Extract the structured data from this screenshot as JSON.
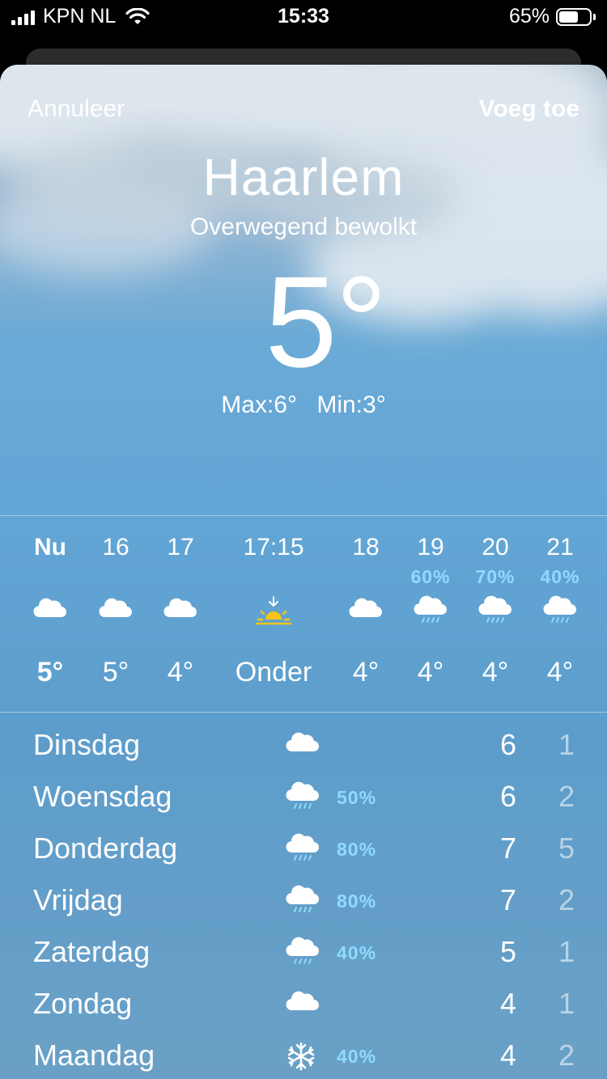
{
  "status_bar": {
    "carrier": "KPN NL",
    "time": "15:33",
    "battery_pct": "65%",
    "battery_level": 0.65,
    "icons": [
      "signal-icon",
      "wifi-icon",
      "battery-icon"
    ]
  },
  "nav": {
    "cancel_label": "Annuleer",
    "add_label": "Voeg toe"
  },
  "current": {
    "city": "Haarlem",
    "condition": "Overwegend bewolkt",
    "temperature": "5°",
    "max": "Max:6°",
    "min": "Min:3°"
  },
  "hourly": [
    {
      "label": "Nu",
      "pct": "",
      "icon": "cloud-icon",
      "temp": "5°",
      "bold": true
    },
    {
      "label": "16",
      "pct": "",
      "icon": "cloud-icon",
      "temp": "5°"
    },
    {
      "label": "17",
      "pct": "",
      "icon": "cloud-icon",
      "temp": "4°"
    },
    {
      "label": "17:15",
      "pct": "",
      "icon": "sunset-icon",
      "temp": "Onder"
    },
    {
      "label": "18",
      "pct": "",
      "icon": "cloud-icon",
      "temp": "4°"
    },
    {
      "label": "19",
      "pct": "60%",
      "icon": "cloud-rain-icon",
      "temp": "4°"
    },
    {
      "label": "20",
      "pct": "70%",
      "icon": "cloud-rain-icon",
      "temp": "4°"
    },
    {
      "label": "21",
      "pct": "40%",
      "icon": "cloud-rain-icon",
      "temp": "4°"
    }
  ],
  "daily": [
    {
      "day": "Dinsdag",
      "icon": "cloud-icon",
      "pct": "",
      "max": "6",
      "min": "1"
    },
    {
      "day": "Woensdag",
      "icon": "cloud-rain-icon",
      "pct": "50%",
      "max": "6",
      "min": "2"
    },
    {
      "day": "Donderdag",
      "icon": "cloud-rain-icon",
      "pct": "80%",
      "max": "7",
      "min": "5"
    },
    {
      "day": "Vrijdag",
      "icon": "cloud-rain-icon",
      "pct": "80%",
      "max": "7",
      "min": "2"
    },
    {
      "day": "Zaterdag",
      "icon": "cloud-rain-icon",
      "pct": "40%",
      "max": "5",
      "min": "1"
    },
    {
      "day": "Zondag",
      "icon": "cloud-icon",
      "pct": "",
      "max": "4",
      "min": "1"
    },
    {
      "day": "Maandag",
      "icon": "snowflake-icon",
      "pct": "40%",
      "max": "4",
      "min": "2"
    }
  ],
  "colors": {
    "precip": "#8fdbff",
    "sun": "#f5c518",
    "min_temp": "rgba(255,255,255,0.55)"
  }
}
